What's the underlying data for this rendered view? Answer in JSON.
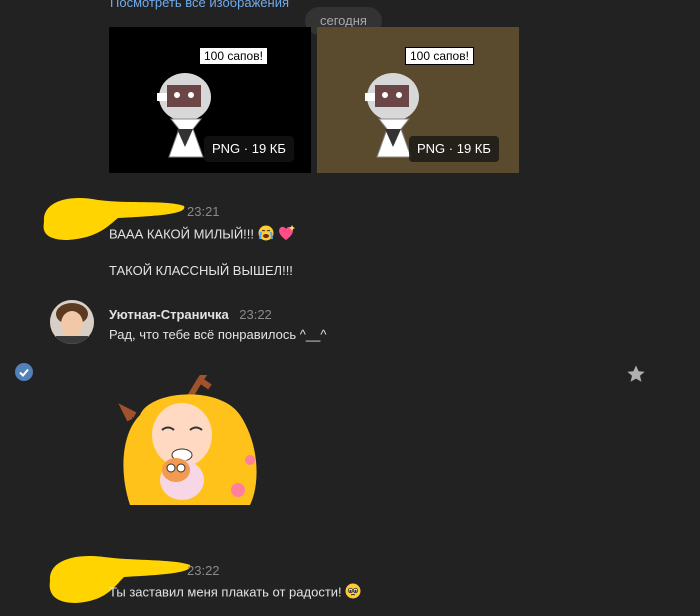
{
  "chat": {
    "view_all_images_link": "Посмотреть все изображения",
    "date_separator": "сегодня",
    "attachments": [
      {
        "badge": "PNG · 19 КБ",
        "speech": "100 сапов!",
        "bg": "#000000"
      },
      {
        "badge": "PNG · 19 КБ",
        "speech": "100 сапов!",
        "bg": "#5a4a2e"
      }
    ],
    "messages": [
      {
        "author": "",
        "time": "23:21",
        "lines": [
          "ВААА КАКОЙ МИЛЫЙ!!!",
          "ТАКОЙ КЛАССНЫЙ ВЫШЕЛ!!!"
        ]
      },
      {
        "author": "Уютная-Страничка",
        "time": "23:22",
        "lines": [
          "Рад, что тебе всё понравилось ^__^"
        ]
      },
      {
        "author": "",
        "time": "23:22",
        "lines": [
          "Ты заставил меня плакать от радости!"
        ]
      }
    ]
  },
  "colors": {
    "background": "#222222",
    "link": "#71aaeb",
    "redaction": "#ffd400",
    "select_check": "#5181b8"
  },
  "icons": [
    "crying-emoji-icon",
    "sparkling-heart-icon",
    "check-circle-icon",
    "star-icon",
    "pleading-face-emoji-icon"
  ]
}
